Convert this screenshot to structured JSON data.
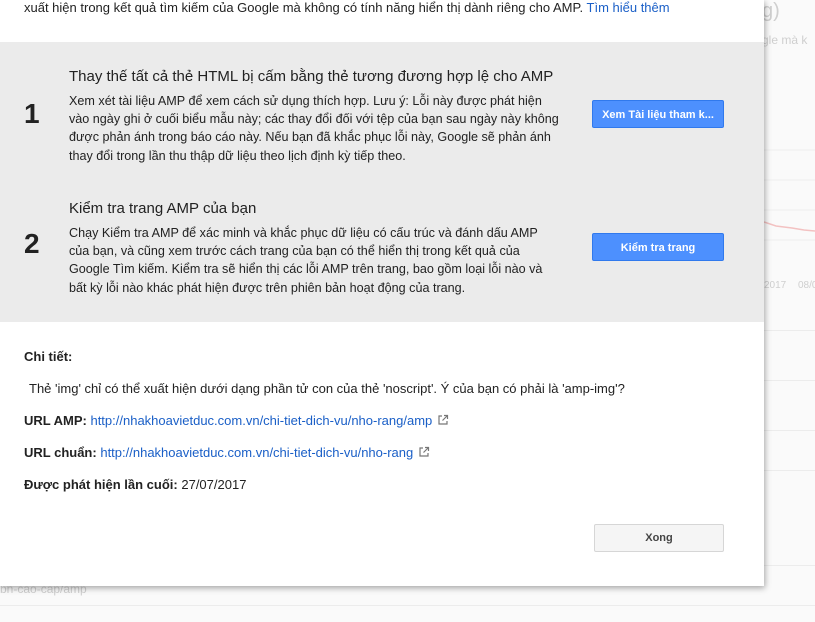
{
  "dialog": {
    "intro_text": "xuất hiện trong kết quả tìm kiếm của Google mà không có tính năng hiển thị dành riêng cho AMP.",
    "intro_link": "Tìm hiểu thêm",
    "steps": [
      {
        "number": "1",
        "title": "Thay thế tất cả thẻ HTML bị cấm bằng thẻ tương đương hợp lệ cho AMP",
        "description": "Xem xét tài liệu AMP để xem cách sử dụng thích hợp. Lưu ý: Lỗi này được phát hiện vào ngày ghi ở cuối biểu mẫu này; các thay đổi đối với tệp của bạn sau ngày này không được phản ánh trong báo cáo này. Nếu bạn đã khắc phục lỗi này, Google sẽ phản ánh thay đổi trong lần thu thập dữ liệu theo lịch định kỳ tiếp theo.",
        "button": "Xem Tài liệu tham k..."
      },
      {
        "number": "2",
        "title": "Kiểm tra trang AMP của bạn",
        "description": "Chạy Kiểm tra AMP để xác minh và khắc phục dữ liệu có cấu trúc và đánh dấu AMP của bạn, và cũng xem trước cách trang của bạn có thể hiển thị trong kết quả của Google Tìm kiếm. Kiểm tra sẽ hiển thị các lỗi AMP trên trang, bao gồm loại lỗi nào và bất kỳ lỗi nào khác phát hiện được trên phiên bản hoạt động của trang.",
        "button": "Kiểm tra trang"
      }
    ],
    "details": {
      "heading": "Chi tiết:",
      "message": "Thẻ 'img' chỉ có thể xuất hiện dưới dạng phần tử con của thẻ 'noscript'. Ý của bạn có phải là 'amp-img'?",
      "amp_url_label": "URL AMP:",
      "amp_url": "http://nhakhoavietduc.com.vn/chi-tiet-dich-vu/nho-rang/amp",
      "canonical_url_label": "URL chuẩn:",
      "canonical_url": "http://nhakhoavietduc.com.vn/chi-tiet-dich-vu/nho-rang",
      "last_detected_label": "Được phát hiện lần cuối:",
      "last_detected": "27/07/2017"
    },
    "done_button": "Xong"
  },
  "background": {
    "paren": "g)",
    "google_text": "gle mà k",
    "date1": "2017",
    "date2": "08/0",
    "path_fragment": "bn-cao-cap/amp"
  },
  "icons": {
    "external_link": "external-link-icon"
  },
  "colors": {
    "link": "#1a5fc7",
    "primary_button": "#4d90fe",
    "panel_bg": "#ebebeb"
  }
}
